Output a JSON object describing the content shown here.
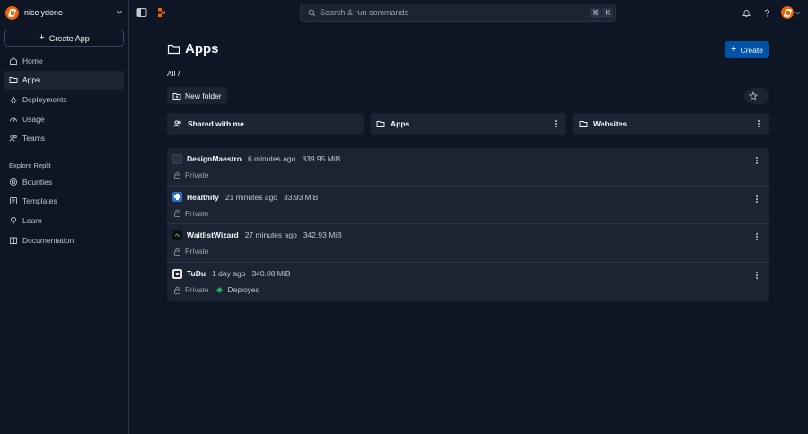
{
  "user": {
    "name": "nicelydone"
  },
  "sidebar": {
    "create_app_label": "Create App",
    "items": [
      {
        "label": "Home",
        "icon": "home-icon"
      },
      {
        "label": "Apps",
        "icon": "folder-icon"
      },
      {
        "label": "Deployments",
        "icon": "deployments-icon"
      },
      {
        "label": "Usage",
        "icon": "usage-icon"
      },
      {
        "label": "Teams",
        "icon": "teams-icon"
      }
    ],
    "explore_label": "Explore Replit",
    "explore_items": [
      {
        "label": "Bounties",
        "icon": "bounties-icon"
      },
      {
        "label": "Templates",
        "icon": "templates-icon"
      },
      {
        "label": "Learn",
        "icon": "learn-icon"
      },
      {
        "label": "Documentation",
        "icon": "book-icon"
      }
    ]
  },
  "search": {
    "placeholder": "Search & run commands",
    "key1": "⌘",
    "key2": "K"
  },
  "page": {
    "title": "Apps",
    "create_label": "Create",
    "breadcrumb": "All /",
    "new_folder_label": "New folder"
  },
  "folders": [
    {
      "label": "Shared with me"
    },
    {
      "label": "Apps"
    },
    {
      "label": "Websites"
    }
  ],
  "apps": [
    {
      "name": "DesignMaestro",
      "time": "6 minutes ago",
      "size": "339.95 MiB",
      "privacy": "Private"
    },
    {
      "name": "Healthify",
      "time": "21 minutes ago",
      "size": "33.93 MiB",
      "privacy": "Private"
    },
    {
      "name": "WaitlistWizard",
      "time": "27 minutes ago",
      "size": "342.93 MiB",
      "privacy": "Private"
    },
    {
      "name": "TuDu",
      "time": "1 day ago",
      "size": "340.08 MiB",
      "privacy": "Private",
      "status": "Deployed"
    }
  ],
  "colors": {
    "accent": "#0053a6",
    "brand": "#f26207",
    "deployed": "#1eb35d"
  }
}
